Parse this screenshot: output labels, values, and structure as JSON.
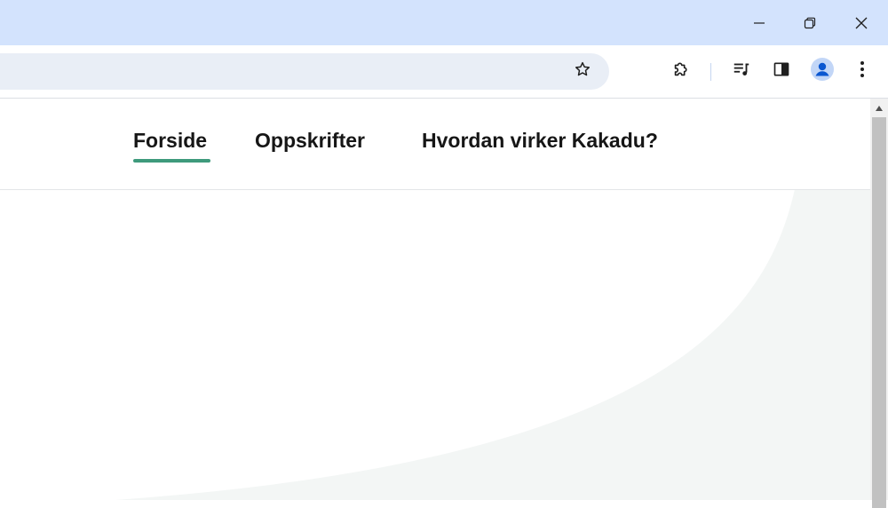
{
  "window": {
    "controls": {
      "minimize": "minimize-icon",
      "restore": "restore-icon",
      "close": "close-icon"
    }
  },
  "toolbar": {
    "bookmark_icon": "star-icon",
    "extensions_icon": "puzzle-icon",
    "media_icon": "media-control-icon",
    "side_panel_icon": "side-panel-icon",
    "profile_icon": "profile-avatar-icon",
    "menu_icon": "more-vertical-icon"
  },
  "site": {
    "nav": {
      "items": [
        {
          "label": "Forside",
          "active": true
        },
        {
          "label": "Oppskrifter",
          "active": false
        },
        {
          "label": "Hvordan virker Kakadu?",
          "active": false
        }
      ],
      "active_color": "#3e9a7c"
    }
  },
  "colors": {
    "titlebar": "#d3e3fd",
    "omnibox": "#e9eef6",
    "page_tint": "#f3f6f5",
    "accent": "#3e9a7c",
    "avatar": "#0b57d0"
  }
}
